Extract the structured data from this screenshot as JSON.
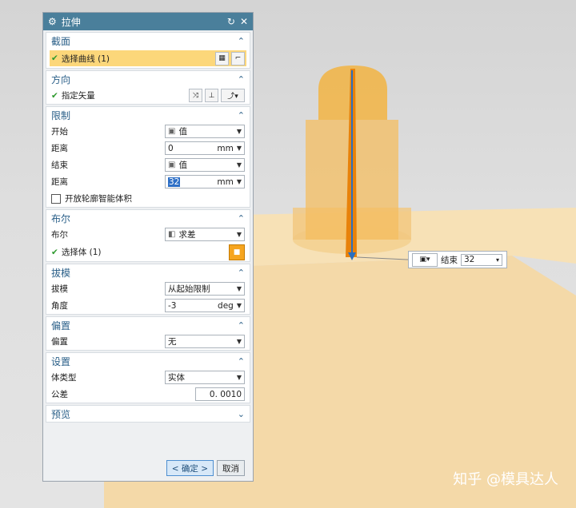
{
  "dialog": {
    "title": "拉伸",
    "icons": {
      "settings": "gear-icon",
      "reset": "reset-icon",
      "close": "close-icon"
    },
    "sections": {
      "section": {
        "title": "截面",
        "selection": "选择曲线 (1)"
      },
      "direction": {
        "title": "方向",
        "vector_label": "指定矢量"
      },
      "limits": {
        "title": "限制",
        "start_label": "开始",
        "start_value": "值",
        "start_dist_label": "距离",
        "start_dist_value": "0",
        "end_label": "结束",
        "end_value": "值",
        "end_dist_label": "距离",
        "end_dist_value": "32",
        "unit": "mm",
        "open_profile_label": "开放轮廓智能体积"
      },
      "boolean": {
        "title": "布尔",
        "boolean_label": "布尔",
        "boolean_value": "求差",
        "select_body": "选择体 (1)"
      },
      "draft": {
        "title": "拔模",
        "draft_label": "拔模",
        "draft_value": "从起始限制",
        "angle_label": "角度",
        "angle_value": "-3",
        "angle_unit": "deg"
      },
      "offset": {
        "title": "偏置",
        "offset_label": "偏置",
        "offset_value": "无"
      },
      "settings": {
        "title": "设置",
        "body_type_label": "体类型",
        "body_type_value": "实体",
        "tolerance_label": "公差",
        "tolerance_value": "0. 0010"
      },
      "preview": {
        "title": "预览"
      }
    },
    "buttons": {
      "ok": "< 确定 >",
      "cancel": "取消"
    }
  },
  "popup": {
    "end_label": "结束",
    "end_value": "32"
  },
  "watermark": "知乎 @模具达人",
  "colors": {
    "title_bar": "#4a7f9b",
    "section_title": "#2a5f88",
    "highlight": "#fcd77a",
    "model": "#f5b43c",
    "accent": "#e8820a"
  }
}
